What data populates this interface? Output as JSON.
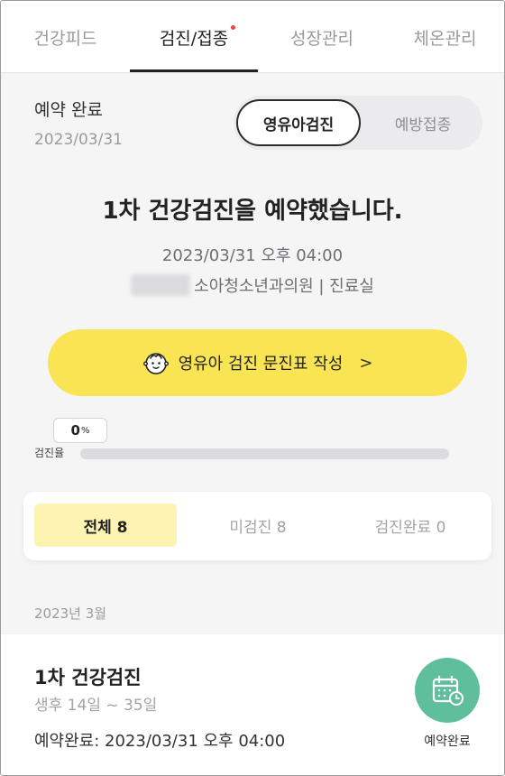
{
  "tabs": [
    {
      "label": "건강피드",
      "active": false
    },
    {
      "label": "검진/접종",
      "active": true,
      "has_new_dot": true
    },
    {
      "label": "성장관리",
      "active": false
    },
    {
      "label": "체온관리",
      "active": false
    }
  ],
  "status": {
    "title": "예약 완료",
    "date": "2023/03/31"
  },
  "segment": {
    "selected": "영유아검진",
    "other": "예방접종"
  },
  "headline": "1차 건강검진을 예약했습니다.",
  "appointment": {
    "datetime": "2023/03/31 오후 04:00",
    "clinic": "소아청소년과의원 | 진료실"
  },
  "cta": {
    "label": "영유아 검진 문진표 작성",
    "icon": "baby-face-icon",
    "chevron": ">"
  },
  "progress": {
    "percent_value": "0",
    "percent_unit": "%",
    "fraction": 0,
    "label": "검진율"
  },
  "filters": [
    {
      "label": "전체 8",
      "active": true
    },
    {
      "label": "미검진 8",
      "active": false
    },
    {
      "label": "검진완료 0",
      "active": false
    }
  ],
  "month_header": "2023년 3월",
  "schedule_item": {
    "title": "1차 건강검진",
    "age_range": "생후 14일 ~ 35일",
    "booked": "예약완료: 2023/03/31 오후 04:00",
    "action_label": "예약완료",
    "action_icon": "calendar-clock-icon"
  },
  "colors": {
    "accent_yellow": "#f9e554",
    "filter_highlight": "#fdf3b3",
    "action_green": "#5fbf9a",
    "notification_dot": "#f0453a"
  }
}
